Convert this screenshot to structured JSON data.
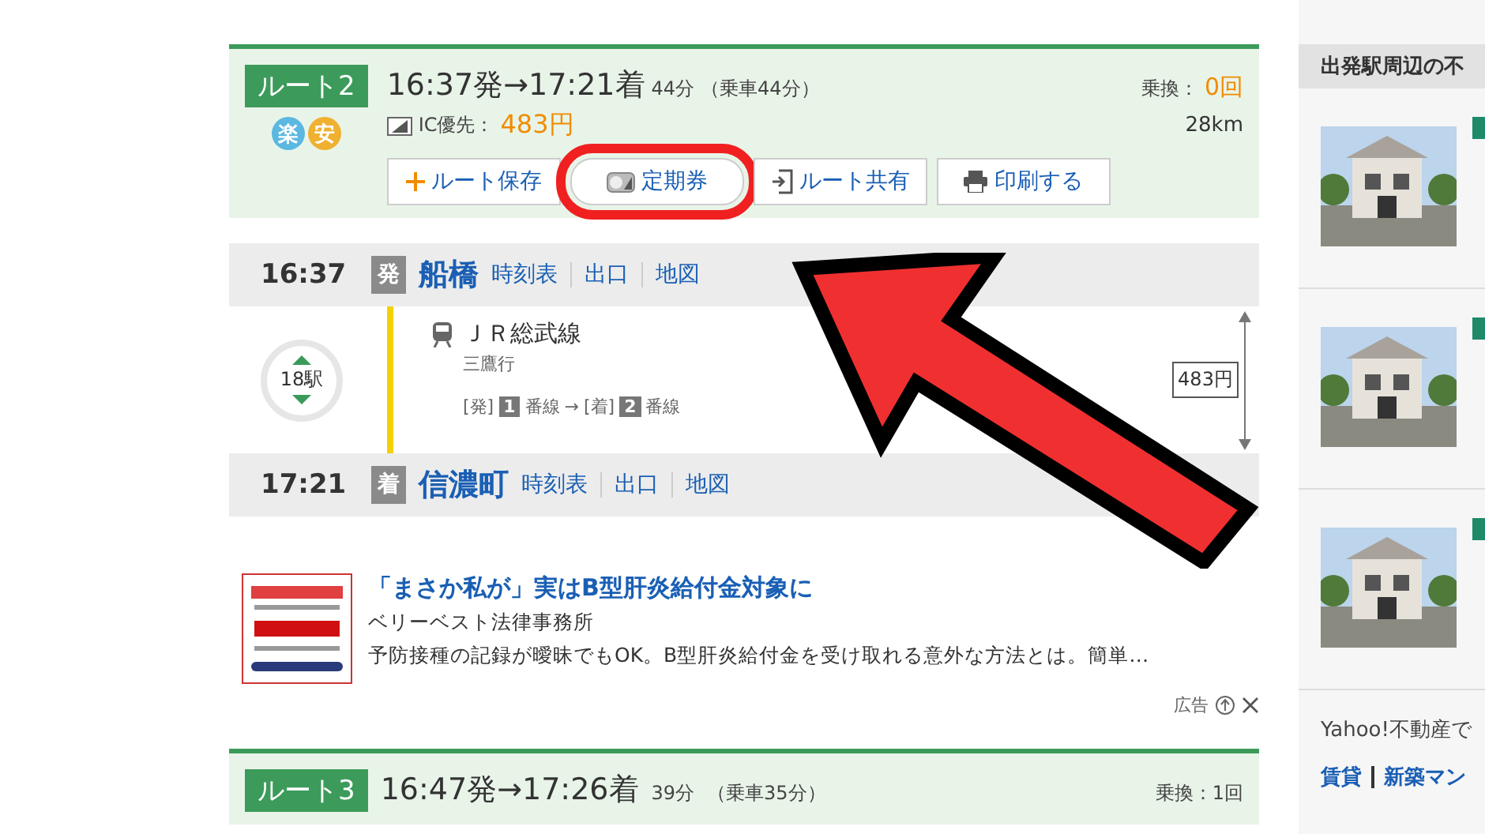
{
  "routes": [
    {
      "badge": "ルート2",
      "times": "16:37発→17:21着",
      "duration": "44分",
      "ride": "（乗車44分）",
      "transfer_label": "乗換：",
      "transfer_value": "0回",
      "ic_label": "IC優先：",
      "fare": "483円",
      "distance": "28km",
      "marks": [
        {
          "text": "楽",
          "color": "#5bb8e0"
        },
        {
          "text": "安",
          "color": "#f0b030"
        }
      ],
      "buttons": [
        {
          "kind": "plus",
          "label": "ルート保存",
          "highlighted": false
        },
        {
          "kind": "pass",
          "label": "定期券",
          "highlighted": true
        },
        {
          "kind": "share",
          "label": "ルート共有",
          "highlighted": false
        },
        {
          "kind": "print",
          "label": "印刷する",
          "highlighted": false
        }
      ]
    }
  ],
  "stations": [
    {
      "time": "16:37",
      "badge": "発",
      "name": "船橋",
      "links": [
        "時刻表",
        "出口",
        "地図"
      ]
    },
    {
      "time": "17:21",
      "badge": "着",
      "name": "信濃町",
      "links": [
        "時刻表",
        "出口",
        "地図"
      ]
    }
  ],
  "segment": {
    "stops": "18駅",
    "line": "ＪＲ総武線",
    "direction": "三鷹行",
    "dep_label": "[発]",
    "dep_no": "1",
    "dep_suffix": "番線",
    "arrow": "→",
    "arr_label": "[着]",
    "arr_no": "2",
    "arr_suffix": "番線",
    "fare": "483円"
  },
  "ad": {
    "title": "「まさか私が」実はB型肝炎給付金対象に",
    "sponsor": "ベリーベスト法律事務所",
    "text": "予防接種の記録が曖昧でもOK。B型肝炎給付金を受け取れる意外な方法とは。簡単…",
    "ad_label": "広告"
  },
  "next_route": {
    "badge": "ルート3",
    "times": "16:47発→17:26着",
    "duration": "39分",
    "ride": "（乗車35分）",
    "transfer": "乗換：1回"
  },
  "sidebar": {
    "heading": "出発駅周辺の不",
    "items": [
      {
        "kind": "listing"
      },
      {
        "kind": "listing"
      },
      {
        "kind": "listing"
      }
    ],
    "footer": "Yahoo!不動産で",
    "links": [
      "賃貸",
      "新築マン"
    ]
  }
}
